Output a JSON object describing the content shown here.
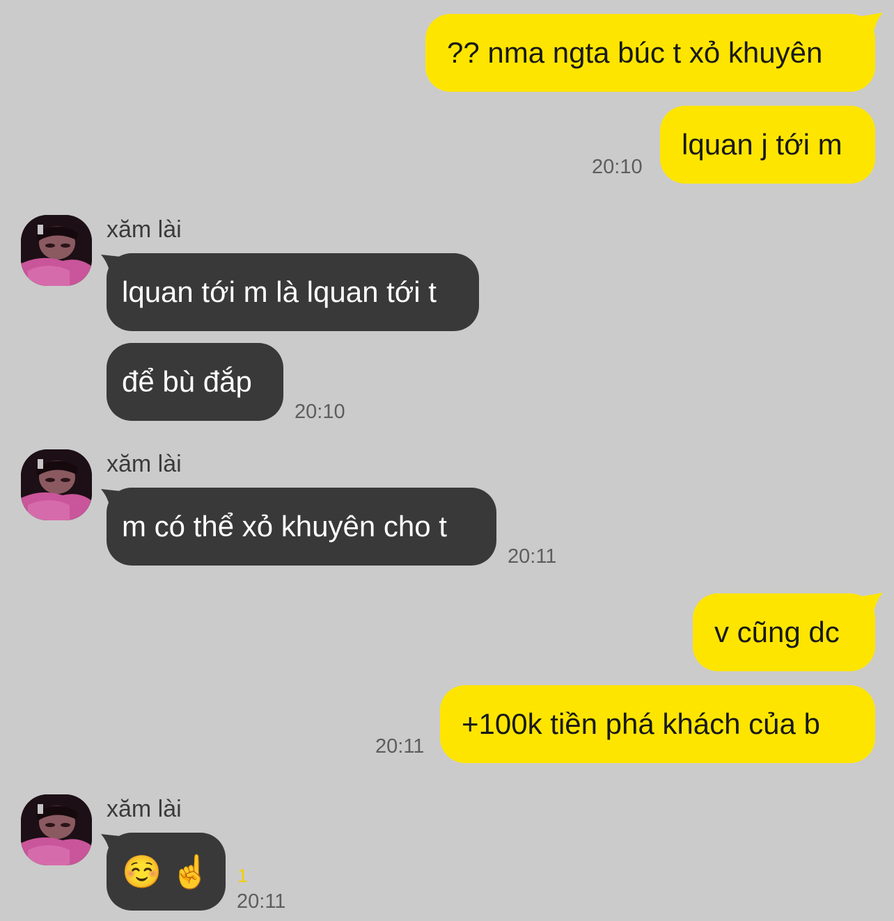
{
  "colors": {
    "background": "#cbcbcb",
    "outgoing_bubble": "#fee500",
    "incoming_bubble": "#393939",
    "timestamp": "#5d5d5d",
    "unread_count": "#f2cf00"
  },
  "messages": [
    {
      "direction": "out",
      "text": "?? nma ngta búc t xỏ khuyên"
    },
    {
      "direction": "out",
      "text": "lquan j tới m",
      "time": "20:10"
    },
    {
      "sender": "xăm lài",
      "avatar_icon": "profile-photo",
      "direction": "in",
      "text": "lquan tới m là lquan tới t"
    },
    {
      "direction": "in",
      "text": "để bù đắp",
      "time": "20:10"
    },
    {
      "sender": "xăm lài",
      "avatar_icon": "profile-photo",
      "direction": "in",
      "text": "m có thể xỏ khuyên cho t",
      "time": "20:11"
    },
    {
      "direction": "out",
      "text": "v cũng dc"
    },
    {
      "direction": "out",
      "text": "+100k tiền phá khách của b",
      "time": "20:11"
    },
    {
      "sender": "xăm lài",
      "avatar_icon": "profile-photo",
      "direction": "in",
      "text": "☺️ ☝️",
      "time": "20:11",
      "unread": "1"
    }
  ]
}
